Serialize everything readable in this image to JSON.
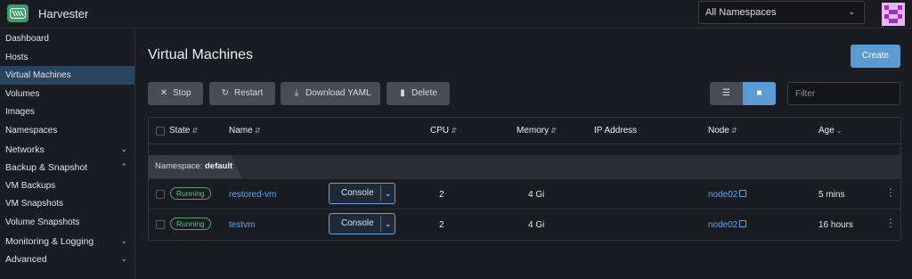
{
  "header": {
    "app_title": "Harvester",
    "namespace_select": "All Namespaces"
  },
  "sidebar": {
    "items": [
      {
        "label": "Dashboard"
      },
      {
        "label": "Hosts"
      },
      {
        "label": "Virtual Machines",
        "active": true
      },
      {
        "label": "Volumes"
      },
      {
        "label": "Images"
      },
      {
        "label": "Namespaces"
      },
      {
        "label": "Networks",
        "expandable": true
      },
      {
        "label": "Backup & Snapshot",
        "expandable": true,
        "expanded": true
      },
      {
        "label": "VM Backups"
      },
      {
        "label": "VM Snapshots"
      },
      {
        "label": "Volume Snapshots"
      },
      {
        "label": "Monitoring & Logging",
        "expandable": true
      },
      {
        "label": "Advanced",
        "expandable": true
      }
    ]
  },
  "main": {
    "title": "Virtual Machines",
    "create_label": "Create",
    "actions": {
      "stop": "Stop",
      "restart": "Restart",
      "download_yaml": "Download YAML",
      "delete": "Delete"
    },
    "filter_placeholder": "Filter",
    "table": {
      "headers": {
        "state": "State",
        "name": "Name",
        "cpu": "CPU",
        "memory": "Memory",
        "ip": "IP Address",
        "node": "Node",
        "age": "Age"
      },
      "group_prefix": "Namespace:",
      "group_name": "default",
      "rows": [
        {
          "state": "Running",
          "name": "restored-vm",
          "console": "Console",
          "cpu": "2",
          "memory": "4 Gi",
          "ip": "",
          "node": "node02",
          "age": "5 mins"
        },
        {
          "state": "Running",
          "name": "testvm",
          "console": "Console",
          "cpu": "2",
          "memory": "4 Gi",
          "ip": "",
          "node": "node02",
          "age": "16 hours"
        }
      ]
    }
  },
  "colors": {
    "background": "#1b1c21",
    "accent": "#5c9ad3",
    "active_nav": "#2a4460",
    "running": "#5fc184",
    "link": "#5ea4e6",
    "logo": "#3d9b6a"
  }
}
